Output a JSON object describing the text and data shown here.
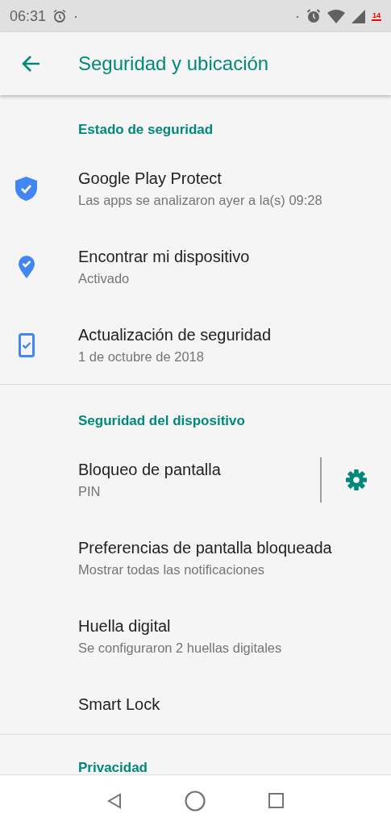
{
  "status_bar": {
    "time": "06:31",
    "dot_left": "·",
    "dot_right": "·",
    "battery": "14"
  },
  "app_bar": {
    "title": "Seguridad y ubicación"
  },
  "sections": [
    {
      "header": "Estado de seguridad",
      "items": [
        {
          "kind": "shield",
          "title": "Google Play Protect",
          "summary": "Las apps se analizaron ayer a la(s) 09:28"
        },
        {
          "kind": "pin",
          "title": "Encontrar mi dispositivo",
          "summary": "Activado"
        },
        {
          "kind": "phone",
          "title": "Actualización de seguridad",
          "summary": "1 de octubre de 2018"
        }
      ]
    },
    {
      "header": "Seguridad del dispositivo",
      "items": [
        {
          "kind": "gear",
          "title": "Bloqueo de pantalla",
          "summary": "PIN"
        },
        {
          "kind": "plain",
          "title": "Preferencias de pantalla bloqueada",
          "summary": "Mostrar todas las notificaciones"
        },
        {
          "kind": "plain",
          "title": "Huella digital",
          "summary": "Se configuraron 2 huellas digitales"
        },
        {
          "kind": "plain",
          "title": "Smart Lock"
        }
      ]
    },
    {
      "header": "Privacidad"
    }
  ]
}
